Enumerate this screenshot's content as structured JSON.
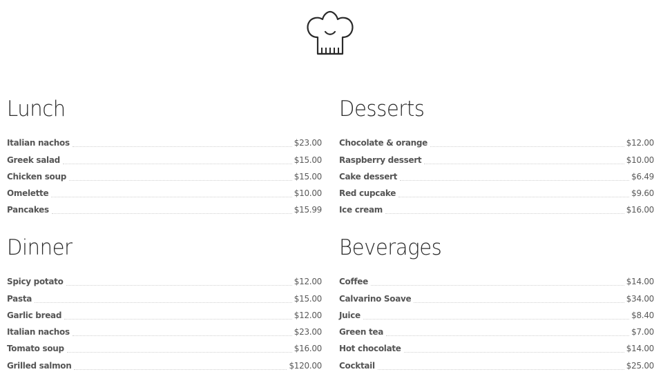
{
  "menu": {
    "lunch": {
      "title": "Lunch",
      "items": [
        {
          "name": "Italian nachos",
          "price": "$23.00"
        },
        {
          "name": "Greek salad",
          "price": "$15.00"
        },
        {
          "name": "Chicken soup",
          "price": "$15.00"
        },
        {
          "name": "Omelette",
          "price": "$10.00"
        },
        {
          "name": "Pancakes",
          "price": "$15.99"
        }
      ]
    },
    "desserts": {
      "title": "Desserts",
      "items": [
        {
          "name": "Chocolate & orange",
          "price": "$12.00"
        },
        {
          "name": "Raspberry dessert",
          "price": "$10.00"
        },
        {
          "name": "Cake dessert",
          "price": "$6.49"
        },
        {
          "name": "Red cupcake",
          "price": "$9.60"
        },
        {
          "name": "Ice cream",
          "price": "$16.00"
        }
      ]
    },
    "dinner": {
      "title": "Dinner",
      "items": [
        {
          "name": "Spicy potato",
          "price": "$12.00"
        },
        {
          "name": "Pasta",
          "price": "$15.00"
        },
        {
          "name": "Garlic bread",
          "price": "$12.00"
        },
        {
          "name": "Italian nachos",
          "price": "$23.00"
        },
        {
          "name": "Tomato soup",
          "price": "$16.00"
        },
        {
          "name": "Grilled salmon",
          "price": "$120.00"
        }
      ]
    },
    "beverages": {
      "title": "Beverages",
      "items": [
        {
          "name": "Coffee",
          "price": "$14.00"
        },
        {
          "name": "Calvarino Soave",
          "price": "$34.00"
        },
        {
          "name": "Juice",
          "price": "$8.40"
        },
        {
          "name": "Green tea",
          "price": "$7.00"
        },
        {
          "name": "Hot chocolate",
          "price": "$14.00"
        },
        {
          "name": "Cocktail",
          "price": "$25.00"
        }
      ]
    }
  },
  "icons": {
    "logo": "chef-hat-icon"
  },
  "colors": {
    "text": "#4a4a4a",
    "heading": "#2a2a2a",
    "leader": "#cfcfcf",
    "background": "#ffffff"
  }
}
